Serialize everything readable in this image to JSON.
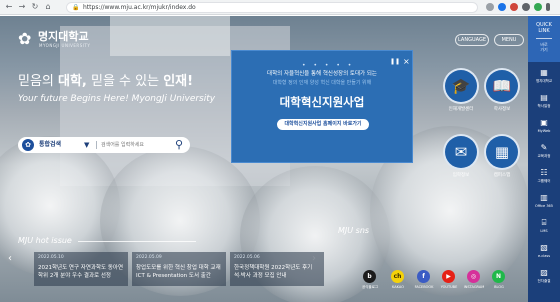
{
  "browser": {
    "url": "https://www.mju.ac.kr/mjukr/index.do",
    "nav": {
      "back": "←",
      "forward": "→",
      "reload": "↻",
      "home": "⌂"
    }
  },
  "site": {
    "logo": {
      "name_ko": "명지대학교",
      "name_en": "MYONGJI UNIVERSITY"
    },
    "top_buttons": [
      "LANGUAGE",
      "MENU"
    ],
    "slogan": {
      "part1": "믿음의 ",
      "bold1": "대학,",
      "part2": " 믿을 수 있는 ",
      "bold2": "인재!"
    },
    "slogan_en": "Your future Begins Here! MyongJi University",
    "search": {
      "category": "통합검색",
      "placeholder": "검색어를 입력하세요",
      "button_icon": "search-icon"
    },
    "popup": {
      "dots": "• • • • •",
      "line1": "대학의 자율혁신을 통해 혁신성장의 토대가 되는",
      "line2": "대학형 정의 인재 양성 혁신 대학을 만들기 위해",
      "title": "대학혁신지원사업",
      "button": "대학혁신지원사업 홈페이지 바로가기",
      "pause": "❚❚",
      "close": "×"
    },
    "quick_circles": [
      {
        "label": "인재개발센터",
        "icon": "graduate-icon"
      },
      {
        "label": "학사정보",
        "icon": "book-icon"
      },
      {
        "label": "입학정보",
        "icon": "admission-icon"
      },
      {
        "label": "캠퍼스맵",
        "icon": "building-icon"
      }
    ],
    "issue": {
      "heading": "MJU hot issue",
      "cards": [
        {
          "date": "2022.05.10",
          "line1": "2021학년도 연구 자연과학도 동아연",
          "line2": "학위 2개 분야 우수 결과로 선정"
        },
        {
          "date": "2022.05.09",
          "line1": "창업도모를 위한 혁신 창업 대학 교재",
          "line2": "ICT & Presentation 도서 출간"
        },
        {
          "date": "2022.05.06",
          "line1": "한국정책대학원 2022학년도 후기",
          "line2": "석·박사 과정 모집 안내"
        }
      ]
    },
    "sns": {
      "heading": "MJU sns",
      "items": [
        {
          "label": "공식블로그",
          "color": "#1c1c1c",
          "glyph": "b"
        },
        {
          "label": "KAKAO",
          "color": "#f5d20a",
          "glyph": "ch"
        },
        {
          "label": "FACEBOOK",
          "color": "#3b5cc4",
          "glyph": "f"
        },
        {
          "label": "YOUTUBE",
          "color": "#e62117",
          "glyph": "▶"
        },
        {
          "label": "INSTAGRAM",
          "color": "#d6309a",
          "glyph": "◎"
        },
        {
          "label": "BLOG",
          "color": "#20b84a",
          "glyph": "N"
        }
      ]
    },
    "quick_links": {
      "title_line1": "QUICK",
      "title_line2": "LINK",
      "sub_line1": "바로",
      "sub_line2": "가기",
      "items": [
        {
          "label": "명지대학교",
          "glyph": "▦"
        },
        {
          "label": "학사일정",
          "glyph": "▤"
        },
        {
          "label": "MyWeb",
          "glyph": "▣"
        },
        {
          "label": "교육과정",
          "glyph": "✎"
        },
        {
          "label": "그룹웨어",
          "glyph": "☷"
        },
        {
          "label": "Office 365",
          "glyph": "▥"
        },
        {
          "label": "LMS",
          "glyph": "⌸"
        },
        {
          "label": "e-class",
          "glyph": "▧"
        },
        {
          "label": "전자출결",
          "glyph": "▨"
        }
      ]
    }
  }
}
